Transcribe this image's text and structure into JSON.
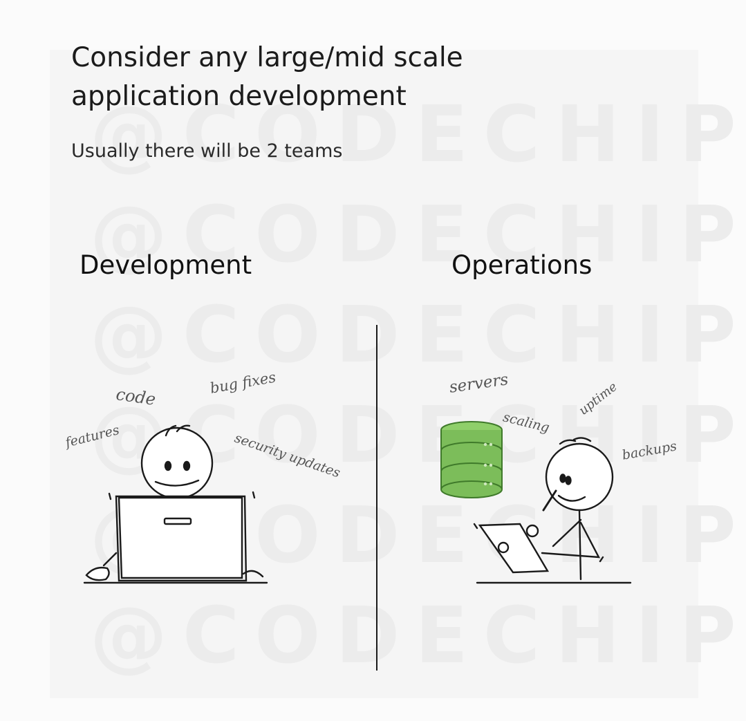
{
  "watermark": "@CODECHIPS",
  "title": "Consider any large/mid scale application development",
  "subtitle": "Usually there will be 2 teams",
  "teams": {
    "left": {
      "name": "Development",
      "tasks": [
        "code",
        "bug fixes",
        "features",
        "security updates"
      ]
    },
    "right": {
      "name": "Operations",
      "tasks": [
        "servers",
        "scaling",
        "uptime",
        "backups"
      ]
    }
  },
  "colors": {
    "server_green": "#7cbd5a",
    "server_dark": "#5a9a3e",
    "ink": "#1a1a1a"
  }
}
